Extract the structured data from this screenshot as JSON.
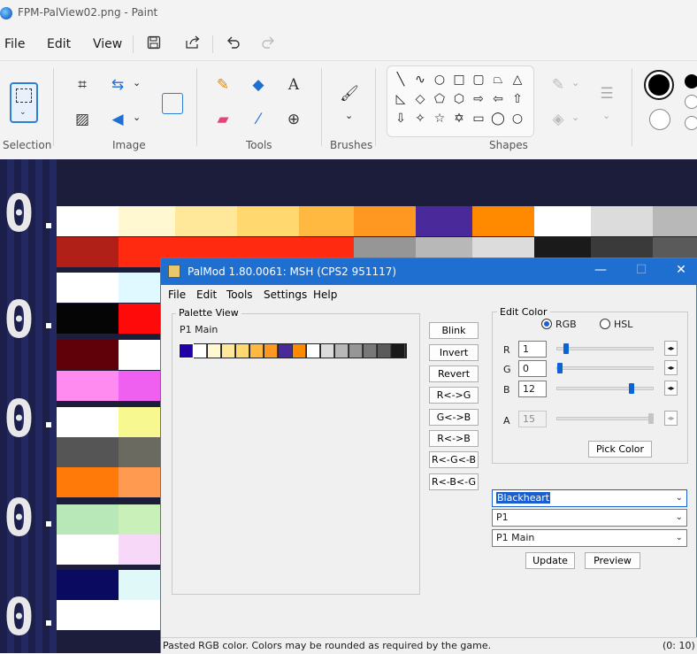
{
  "window": {
    "title": "FPM-PalView02.png - Paint"
  },
  "menu": {
    "file": "File",
    "edit": "Edit",
    "view": "View"
  },
  "ribbon": {
    "selection_label": "Selection",
    "image_label": "Image",
    "tools_label": "Tools",
    "brushes_label": "Brushes",
    "shapes_label": "Shapes",
    "text_tool_glyph": "A"
  },
  "canvas": {
    "digit": "0"
  },
  "palmod": {
    "title": "PalMod 1.80.0061: MSH (CPS2 951117)",
    "menu": [
      "File",
      "Edit",
      "Tools",
      "Settings",
      "Help"
    ],
    "palette_view": {
      "label": "Palette View",
      "palette_name": "P1 Main",
      "swatches": [
        "#2200a8",
        "#ffffff",
        "#fff8d0",
        "#ffe89a",
        "#ffd870",
        "#ffb840",
        "#ff9820",
        "#4a2a9a",
        "#ff8a00",
        "#ffffff",
        "#dcdcdc",
        "#b8b8b8",
        "#969696",
        "#787878",
        "#5a5a5a",
        "#1a1a1a"
      ]
    },
    "buttons": [
      "Blink",
      "Invert",
      "Revert",
      "R<->G",
      "G<->B",
      "R<->B",
      "R<-G<-B",
      "R<-B<-G"
    ],
    "edit_color": {
      "label": "Edit Color",
      "rgb_label": "RGB",
      "hsl_label": "HSL",
      "r_label": "R",
      "r_value": "1",
      "g_label": "G",
      "g_value": "0",
      "b_label": "B",
      "b_value": "12",
      "a_label": "A",
      "a_value": "15",
      "pick_color": "Pick Color"
    },
    "game_select": "Blackheart",
    "unit_select": "P1",
    "palette_select": "P1 Main",
    "update": "Update",
    "preview": "Preview",
    "status": "Pasted RGB color. Colors may be rounded as required by the game.",
    "status_pos": "(0: 10)"
  },
  "colors": {
    "accent": "#1f6fd0",
    "paint_bg": "#f3f3f3",
    "canvas_bg": "#1b1d3a"
  }
}
